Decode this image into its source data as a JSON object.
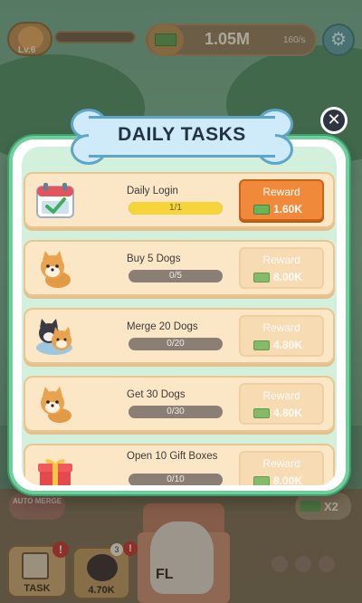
{
  "hud": {
    "level": "Lv.6",
    "cash": "1.05M",
    "cash_rate": "160/s",
    "settings_icon": "gear-icon"
  },
  "modal": {
    "title": "DAILY TASKS",
    "close_label": "✕",
    "tasks": [
      {
        "title": "Daily Login",
        "progress_text": "1/1",
        "progress": 1.0,
        "reward_label": "Reward",
        "reward_amount": "1.60K",
        "claimable": true,
        "icon": "calendar-check-icon"
      },
      {
        "title": "Buy 5 Dogs",
        "progress_text": "0/5",
        "progress": 0.0,
        "reward_label": "Reward",
        "reward_amount": "8.00K",
        "claimable": false,
        "icon": "shiba-dog-icon"
      },
      {
        "title": "Merge 20 Dogs",
        "progress_text": "0/20",
        "progress": 0.0,
        "reward_label": "Reward",
        "reward_amount": "4.80K",
        "claimable": false,
        "icon": "merge-dogs-icon"
      },
      {
        "title": "Get 30 Dogs",
        "progress_text": "0/30",
        "progress": 0.0,
        "reward_label": "Reward",
        "reward_amount": "4.80K",
        "claimable": false,
        "icon": "shiba-dog-icon"
      },
      {
        "title": "Open 10 Gift Boxes",
        "progress_text": "0/10",
        "progress": 0.0,
        "reward_label": "Reward",
        "reward_amount": "8.00K",
        "claimable": false,
        "icon": "gift-box-icon"
      }
    ]
  },
  "bottom": {
    "task_label": "TASK",
    "task_alert": "!",
    "dog_price": "4.70K",
    "dog_count": "3",
    "dog_alert": "!",
    "merge_label": "AUTO MERGE",
    "x2_label": "X2",
    "house_label": "FL"
  },
  "colors": {
    "modal_border": "#6fcf9b",
    "modal_bg": "#d3f0dd",
    "card_bg": "#fbe7c6",
    "reward_active": "#f08a3a",
    "progress_fill": "#f5d53a"
  }
}
